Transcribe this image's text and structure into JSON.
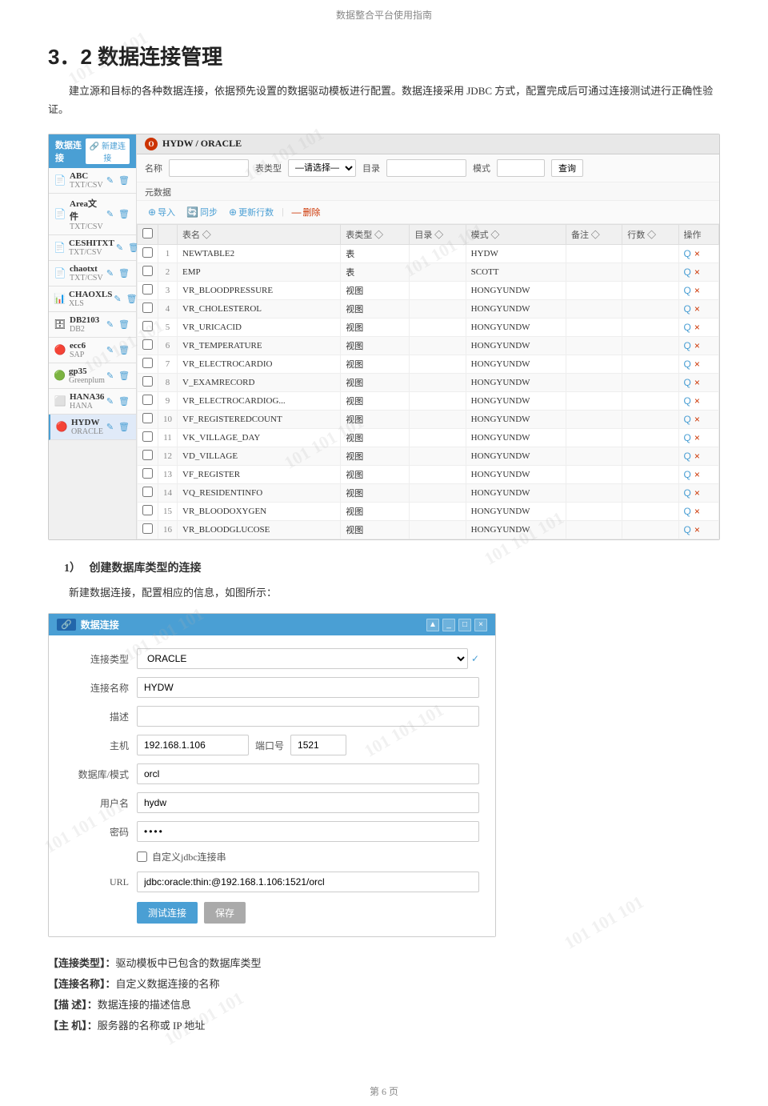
{
  "page": {
    "header": "数据整合平台使用指南",
    "footer": "第 6 页"
  },
  "section": {
    "title": "3．2 数据连接管理",
    "intro": "建立源和目标的各种数据连接，依据预先设置的数据驱动模板进行配置。数据连接采用 JDBC 方式，配置完成后可通过连接测试进行正确性验证。"
  },
  "sidebar": {
    "header": "数据连接",
    "new_btn": "🔗 新建连接",
    "items": [
      {
        "icon": "📄",
        "name": "ABC",
        "sub": "TXT/CSV",
        "active": false
      },
      {
        "icon": "📄",
        "name": "Area文件",
        "sub": "TXT/CSV",
        "active": false
      },
      {
        "icon": "📄",
        "name": "CESHITXT",
        "sub": "TXT/CSV",
        "active": false
      },
      {
        "icon": "📄",
        "name": "chaotxt",
        "sub": "TXT/CSV",
        "active": false
      },
      {
        "icon": "📊",
        "name": "CHAOXLS",
        "sub": "XLS",
        "active": false
      },
      {
        "icon": "🗄",
        "name": "DB2103",
        "sub": "DB2",
        "active": false
      },
      {
        "icon": "🔴",
        "name": "ecc6",
        "sub": "SAP",
        "active": false
      },
      {
        "icon": "🟢",
        "name": "gp35",
        "sub": "Greenplum",
        "active": false
      },
      {
        "icon": "⬜",
        "name": "HANA36",
        "sub": "HANA",
        "active": false
      },
      {
        "icon": "🔴",
        "name": "HYDW",
        "sub": "ORACLE",
        "active": true
      }
    ]
  },
  "main_panel": {
    "title": "HYDW / ORACLE",
    "filters": {
      "name_label": "名称",
      "name_placeholder": "",
      "table_type_label": "表类型",
      "table_type_value": "—请选择—",
      "target_label": "目录",
      "target_placeholder": "",
      "schema_label": "模式",
      "schema_placeholder": "",
      "query_btn": "查询"
    },
    "metadata_label": "元数据",
    "toolbar": {
      "import": "导入",
      "sync": "同步",
      "refresh": "更新行数",
      "delete": "删除"
    },
    "table": {
      "columns": [
        "",
        "",
        "表名",
        "表类型",
        "目录",
        "模式",
        "备注",
        "行数",
        "操作"
      ],
      "rows": [
        {
          "num": 1,
          "name": "NEWTABLE2",
          "type": "表",
          "catalog": "",
          "schema": "HYDW",
          "remark": "",
          "rows": "",
          "actions": true
        },
        {
          "num": 2,
          "name": "EMP",
          "type": "表",
          "catalog": "",
          "schema": "SCOTT",
          "remark": "",
          "rows": "",
          "actions": true
        },
        {
          "num": 3,
          "name": "VR_BLOODPRESSURE",
          "type": "视图",
          "catalog": "",
          "schema": "HONGYUNDW",
          "remark": "",
          "rows": "",
          "actions": true
        },
        {
          "num": 4,
          "name": "VR_CHOLESTEROL",
          "type": "视图",
          "catalog": "",
          "schema": "HONGYUNDW",
          "remark": "",
          "rows": "",
          "actions": true
        },
        {
          "num": 5,
          "name": "VR_URICACID",
          "type": "视图",
          "catalog": "",
          "schema": "HONGYUNDW",
          "remark": "",
          "rows": "",
          "actions": true
        },
        {
          "num": 6,
          "name": "VR_TEMPERATURE",
          "type": "视图",
          "catalog": "",
          "schema": "HONGYUNDW",
          "remark": "",
          "rows": "",
          "actions": true
        },
        {
          "num": 7,
          "name": "VR_ELECTROCARDIO",
          "type": "视图",
          "catalog": "",
          "schema": "HONGYUNDW",
          "remark": "",
          "rows": "",
          "actions": true
        },
        {
          "num": 8,
          "name": "V_EXAMRECORD",
          "type": "视图",
          "catalog": "",
          "schema": "HONGYUNDW",
          "remark": "",
          "rows": "",
          "actions": true
        },
        {
          "num": 9,
          "name": "VR_ELECTROCARDIOG...",
          "type": "视图",
          "catalog": "",
          "schema": "HONGYUNDW",
          "remark": "",
          "rows": "",
          "actions": true
        },
        {
          "num": 10,
          "name": "VF_REGISTEREDCOUNT",
          "type": "视图",
          "catalog": "",
          "schema": "HONGYUNDW",
          "remark": "",
          "rows": "",
          "actions": true
        },
        {
          "num": 11,
          "name": "VK_VILLAGE_DAY",
          "type": "视图",
          "catalog": "",
          "schema": "HONGYUNDW",
          "remark": "",
          "rows": "",
          "actions": true
        },
        {
          "num": 12,
          "name": "VD_VILLAGE",
          "type": "视图",
          "catalog": "",
          "schema": "HONGYUNDW",
          "remark": "",
          "rows": "",
          "actions": true
        },
        {
          "num": 13,
          "name": "VF_REGISTER",
          "type": "视图",
          "catalog": "",
          "schema": "HONGYUNDW",
          "remark": "",
          "rows": "",
          "actions": true
        },
        {
          "num": 14,
          "name": "VQ_RESIDENTINFO",
          "type": "视图",
          "catalog": "",
          "schema": "HONGYUNDW",
          "remark": "",
          "rows": "",
          "actions": true
        },
        {
          "num": 15,
          "name": "VR_BLOODOXYGEN",
          "type": "视图",
          "catalog": "",
          "schema": "HONGYUNDW",
          "remark": "",
          "rows": "",
          "actions": true
        },
        {
          "num": 16,
          "name": "VR_BLOODGLUCOSE",
          "type": "视图",
          "catalog": "",
          "schema": "HONGYUNDW",
          "remark": "",
          "rows": "",
          "actions": true
        }
      ]
    }
  },
  "subsection": {
    "number": "1）",
    "title": "创建数据库类型的连接",
    "intro": "新建数据连接，配置相应的信息，如图所示："
  },
  "dialog": {
    "title": "数据连接",
    "title_icon": "🔗",
    "form": {
      "conn_type_label": "连接类型",
      "conn_type_value": "ORACLE",
      "conn_name_label": "连接名称",
      "conn_name_value": "HYDW",
      "desc_label": "描述",
      "desc_value": "",
      "host_label": "主机",
      "host_value": "192.168.1.106",
      "port_label": "端口号",
      "port_value": "1521",
      "db_mode_label": "数据库/模式",
      "db_mode_value": "orcl",
      "username_label": "用户名",
      "username_value": "hydw",
      "password_label": "密码",
      "password_value": "••••",
      "custom_jdbc_label": "自定义jdbc连接串",
      "url_label": "URL",
      "url_value": "jdbc:oracle:thin:@192.168.1.106:1521/orcl",
      "test_btn": "测试连接",
      "save_btn": "保存"
    }
  },
  "explanation": {
    "items": [
      {
        "term": "【连接类型】：",
        "desc": "驱动模板中已包含的数据库类型"
      },
      {
        "term": "【连接名称】：",
        "desc": "自定义数据连接的名称"
      },
      {
        "term": "【描    述】：",
        "desc": "数据连接的描述信息"
      },
      {
        "term": "【主    机】：",
        "desc": "服务器的名称或 IP 地址"
      }
    ]
  }
}
